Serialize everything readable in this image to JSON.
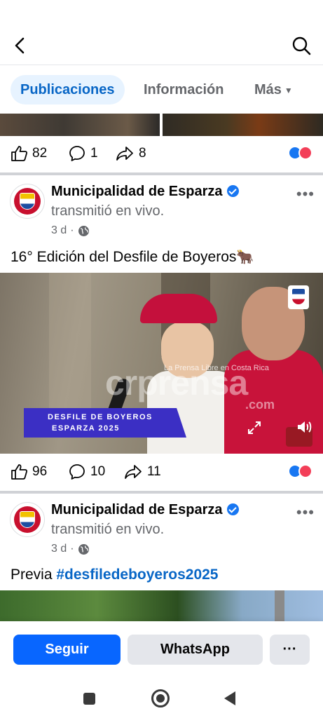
{
  "header": {
    "back_icon": "chevron-left-icon",
    "search_icon": "search-icon"
  },
  "tabs": [
    {
      "label": "Publicaciones",
      "active": true
    },
    {
      "label": "Información",
      "active": false
    },
    {
      "label": "Más",
      "active": false
    }
  ],
  "post0": {
    "likes": "82",
    "comments": "1",
    "shares": "8"
  },
  "post1": {
    "page_name": "Municipalidad de Esparza",
    "action": "transmitió en vivo.",
    "time": "3 d",
    "dot": "·",
    "text": "16° Edición del Desfile de Boyeros",
    "emoji": "🐂",
    "video": {
      "banner_line1": "DESFILE DE BOYEROS",
      "banner_line2": "ESPARZA 2025",
      "watermark": "crprensa",
      "watermark_sub": "La Prensa Libre en Costa Rica",
      "watermark_com": ".com"
    },
    "likes": "96",
    "comments": "10",
    "shares": "11"
  },
  "post2": {
    "page_name": "Municipalidad de Esparza",
    "action": "transmitió en vivo.",
    "time": "3 d",
    "dot": "·",
    "text_prefix": "Previa ",
    "hashtag": "#desfiledeboyeros2025"
  },
  "bottom_actions": {
    "follow": "Seguir",
    "whatsapp": "WhatsApp",
    "more": "···"
  },
  "colors": {
    "accent": "#0866ff",
    "tab_active_bg": "#e7f3ff",
    "tab_active_text": "#0866c6",
    "muted_text": "#65676b",
    "like_blue": "#1877f2",
    "love_red": "#f33e58"
  }
}
